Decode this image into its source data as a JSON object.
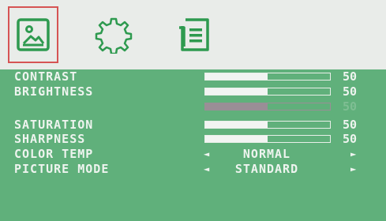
{
  "menu": {
    "tabs": [
      {
        "icon": "picture-icon",
        "active": true
      },
      {
        "icon": "gear-icon",
        "active": false
      },
      {
        "icon": "document-icon",
        "active": false
      }
    ],
    "active_color": "#d65454",
    "icon_color": "#2e9a4f"
  },
  "settings": {
    "contrast": {
      "label": "CONTRAST",
      "value": "50",
      "level": 0.5
    },
    "brightness": {
      "label": "BRIGHTNESS",
      "value": "50",
      "level": 0.5
    },
    "disabled": {
      "value": "50",
      "level": 0.5
    },
    "saturation": {
      "label": "SATURATION",
      "value": "50",
      "level": 0.5
    },
    "sharpness": {
      "label": "SHARPNESS",
      "value": "50",
      "level": 0.5
    },
    "color_temp": {
      "label": "COLOR TEMP",
      "option": "NORMAL"
    },
    "picture_mode": {
      "label": "PICTURE MODE",
      "option": "STANDARD"
    }
  }
}
